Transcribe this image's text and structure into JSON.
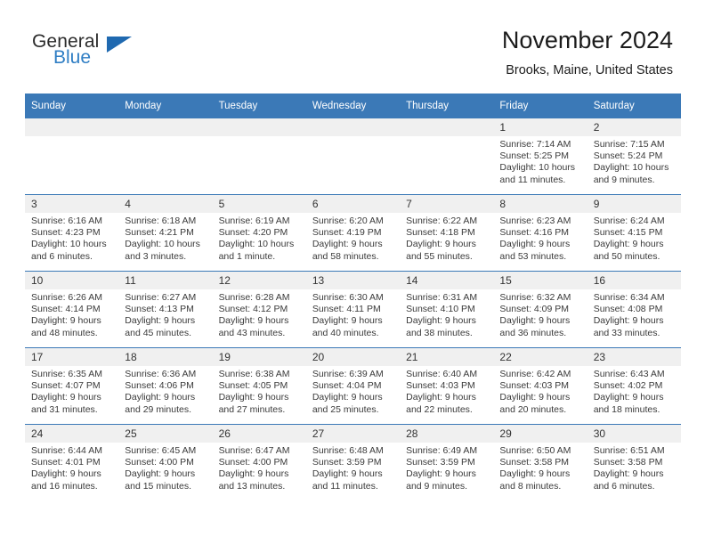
{
  "logo": {
    "word_top": "General",
    "word_bottom": "Blue",
    "triangle_color": "#1f69b0",
    "blue_text_color": "#2f7ec4"
  },
  "header": {
    "title": "November 2024",
    "subtitle": "Brooks, Maine, United States"
  },
  "theme": {
    "header_blue": "#3b79b7",
    "daynum_band": "#f0f0f0",
    "text": "#333333"
  },
  "calendar": {
    "weekday_headers": [
      "Sunday",
      "Monday",
      "Tuesday",
      "Wednesday",
      "Thursday",
      "Friday",
      "Saturday"
    ],
    "labels": {
      "sunrise": "Sunrise:",
      "sunset": "Sunset:",
      "daylight": "Daylight:"
    },
    "weeks": [
      [
        {
          "day": "",
          "empty": true
        },
        {
          "day": "",
          "empty": true
        },
        {
          "day": "",
          "empty": true
        },
        {
          "day": "",
          "empty": true
        },
        {
          "day": "",
          "empty": true
        },
        {
          "day": "1",
          "sunrise": "Sunrise: 7:14 AM",
          "sunset": "Sunset: 5:25 PM",
          "daylight": "Daylight: 10 hours and 11 minutes."
        },
        {
          "day": "2",
          "sunrise": "Sunrise: 7:15 AM",
          "sunset": "Sunset: 5:24 PM",
          "daylight": "Daylight: 10 hours and 9 minutes."
        }
      ],
      [
        {
          "day": "3",
          "sunrise": "Sunrise: 6:16 AM",
          "sunset": "Sunset: 4:23 PM",
          "daylight": "Daylight: 10 hours and 6 minutes."
        },
        {
          "day": "4",
          "sunrise": "Sunrise: 6:18 AM",
          "sunset": "Sunset: 4:21 PM",
          "daylight": "Daylight: 10 hours and 3 minutes."
        },
        {
          "day": "5",
          "sunrise": "Sunrise: 6:19 AM",
          "sunset": "Sunset: 4:20 PM",
          "daylight": "Daylight: 10 hours and 1 minute."
        },
        {
          "day": "6",
          "sunrise": "Sunrise: 6:20 AM",
          "sunset": "Sunset: 4:19 PM",
          "daylight": "Daylight: 9 hours and 58 minutes."
        },
        {
          "day": "7",
          "sunrise": "Sunrise: 6:22 AM",
          "sunset": "Sunset: 4:18 PM",
          "daylight": "Daylight: 9 hours and 55 minutes."
        },
        {
          "day": "8",
          "sunrise": "Sunrise: 6:23 AM",
          "sunset": "Sunset: 4:16 PM",
          "daylight": "Daylight: 9 hours and 53 minutes."
        },
        {
          "day": "9",
          "sunrise": "Sunrise: 6:24 AM",
          "sunset": "Sunset: 4:15 PM",
          "daylight": "Daylight: 9 hours and 50 minutes."
        }
      ],
      [
        {
          "day": "10",
          "sunrise": "Sunrise: 6:26 AM",
          "sunset": "Sunset: 4:14 PM",
          "daylight": "Daylight: 9 hours and 48 minutes."
        },
        {
          "day": "11",
          "sunrise": "Sunrise: 6:27 AM",
          "sunset": "Sunset: 4:13 PM",
          "daylight": "Daylight: 9 hours and 45 minutes."
        },
        {
          "day": "12",
          "sunrise": "Sunrise: 6:28 AM",
          "sunset": "Sunset: 4:12 PM",
          "daylight": "Daylight: 9 hours and 43 minutes."
        },
        {
          "day": "13",
          "sunrise": "Sunrise: 6:30 AM",
          "sunset": "Sunset: 4:11 PM",
          "daylight": "Daylight: 9 hours and 40 minutes."
        },
        {
          "day": "14",
          "sunrise": "Sunrise: 6:31 AM",
          "sunset": "Sunset: 4:10 PM",
          "daylight": "Daylight: 9 hours and 38 minutes."
        },
        {
          "day": "15",
          "sunrise": "Sunrise: 6:32 AM",
          "sunset": "Sunset: 4:09 PM",
          "daylight": "Daylight: 9 hours and 36 minutes."
        },
        {
          "day": "16",
          "sunrise": "Sunrise: 6:34 AM",
          "sunset": "Sunset: 4:08 PM",
          "daylight": "Daylight: 9 hours and 33 minutes."
        }
      ],
      [
        {
          "day": "17",
          "sunrise": "Sunrise: 6:35 AM",
          "sunset": "Sunset: 4:07 PM",
          "daylight": "Daylight: 9 hours and 31 minutes."
        },
        {
          "day": "18",
          "sunrise": "Sunrise: 6:36 AM",
          "sunset": "Sunset: 4:06 PM",
          "daylight": "Daylight: 9 hours and 29 minutes."
        },
        {
          "day": "19",
          "sunrise": "Sunrise: 6:38 AM",
          "sunset": "Sunset: 4:05 PM",
          "daylight": "Daylight: 9 hours and 27 minutes."
        },
        {
          "day": "20",
          "sunrise": "Sunrise: 6:39 AM",
          "sunset": "Sunset: 4:04 PM",
          "daylight": "Daylight: 9 hours and 25 minutes."
        },
        {
          "day": "21",
          "sunrise": "Sunrise: 6:40 AM",
          "sunset": "Sunset: 4:03 PM",
          "daylight": "Daylight: 9 hours and 22 minutes."
        },
        {
          "day": "22",
          "sunrise": "Sunrise: 6:42 AM",
          "sunset": "Sunset: 4:03 PM",
          "daylight": "Daylight: 9 hours and 20 minutes."
        },
        {
          "day": "23",
          "sunrise": "Sunrise: 6:43 AM",
          "sunset": "Sunset: 4:02 PM",
          "daylight": "Daylight: 9 hours and 18 minutes."
        }
      ],
      [
        {
          "day": "24",
          "sunrise": "Sunrise: 6:44 AM",
          "sunset": "Sunset: 4:01 PM",
          "daylight": "Daylight: 9 hours and 16 minutes."
        },
        {
          "day": "25",
          "sunrise": "Sunrise: 6:45 AM",
          "sunset": "Sunset: 4:00 PM",
          "daylight": "Daylight: 9 hours and 15 minutes."
        },
        {
          "day": "26",
          "sunrise": "Sunrise: 6:47 AM",
          "sunset": "Sunset: 4:00 PM",
          "daylight": "Daylight: 9 hours and 13 minutes."
        },
        {
          "day": "27",
          "sunrise": "Sunrise: 6:48 AM",
          "sunset": "Sunset: 3:59 PM",
          "daylight": "Daylight: 9 hours and 11 minutes."
        },
        {
          "day": "28",
          "sunrise": "Sunrise: 6:49 AM",
          "sunset": "Sunset: 3:59 PM",
          "daylight": "Daylight: 9 hours and 9 minutes."
        },
        {
          "day": "29",
          "sunrise": "Sunrise: 6:50 AM",
          "sunset": "Sunset: 3:58 PM",
          "daylight": "Daylight: 9 hours and 8 minutes."
        },
        {
          "day": "30",
          "sunrise": "Sunrise: 6:51 AM",
          "sunset": "Sunset: 3:58 PM",
          "daylight": "Daylight: 9 hours and 6 minutes."
        }
      ]
    ]
  }
}
